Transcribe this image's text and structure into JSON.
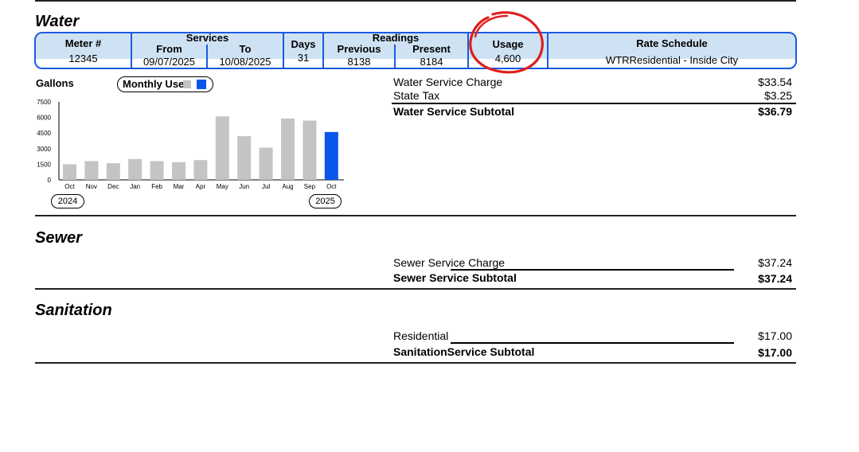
{
  "water": {
    "title": "Water",
    "table": {
      "meter_header": "Meter #",
      "meter_value": "12345",
      "services_header": "Services",
      "from_header": "From",
      "from_value": "09/07/2025",
      "to_header": "To",
      "to_value": "10/08/2025",
      "days_header": "Days",
      "days_value": "31",
      "readings_header": "Readings",
      "previous_header": "Previous",
      "previous_value": "8138",
      "present_header": "Present",
      "present_value": "8184",
      "usage_header": "Usage",
      "usage_value": "4,600",
      "rate_header": "Rate Schedule",
      "rate_value": "WTRResidential - Inside City"
    },
    "charges": [
      {
        "label": "Water Service Charge",
        "amount": "$33.54"
      },
      {
        "label": "State Tax",
        "amount": "$3.25"
      }
    ],
    "subtotal": {
      "label": "Water Service Subtotal",
      "amount": "$36.79"
    }
  },
  "chart_data": {
    "type": "bar",
    "title": "Gallons",
    "legend": "Monthly Use",
    "categories": [
      "Oct",
      "Nov",
      "Dec",
      "Jan",
      "Feb",
      "Mar",
      "Apr",
      "May",
      "Jun",
      "Jul",
      "Aug",
      "Sep",
      "Oct"
    ],
    "values": [
      1500,
      1800,
      1600,
      2000,
      1800,
      1700,
      1900,
      6100,
      4200,
      3100,
      5900,
      5700,
      4600
    ],
    "highlight_index": 12,
    "colors": {
      "normal": "#c4c4c4",
      "current": "#0a56ea"
    },
    "ylim": [
      0,
      7500
    ],
    "yticks": [
      "7500",
      "6000",
      "4500",
      "3000",
      "1500",
      "0"
    ],
    "years": [
      "2024",
      "2025"
    ]
  },
  "sewer": {
    "title": "Sewer",
    "charges": [
      {
        "label": "Sewer Service Charge",
        "amount": "$37.24"
      }
    ],
    "subtotal": {
      "label": "Sewer Service Subtotal",
      "amount": "$37.24"
    }
  },
  "sanitation": {
    "title": "Sanitation",
    "charges": [
      {
        "label": "Residential",
        "amount": "$17.00"
      }
    ],
    "subtotal": {
      "label": "SanitationService Subtotal",
      "amount": "$17.00"
    }
  },
  "colors": {
    "table_border": "#1a5be0",
    "table_header_bg": "#cfe2f3",
    "annotation": "#e01e1e"
  }
}
